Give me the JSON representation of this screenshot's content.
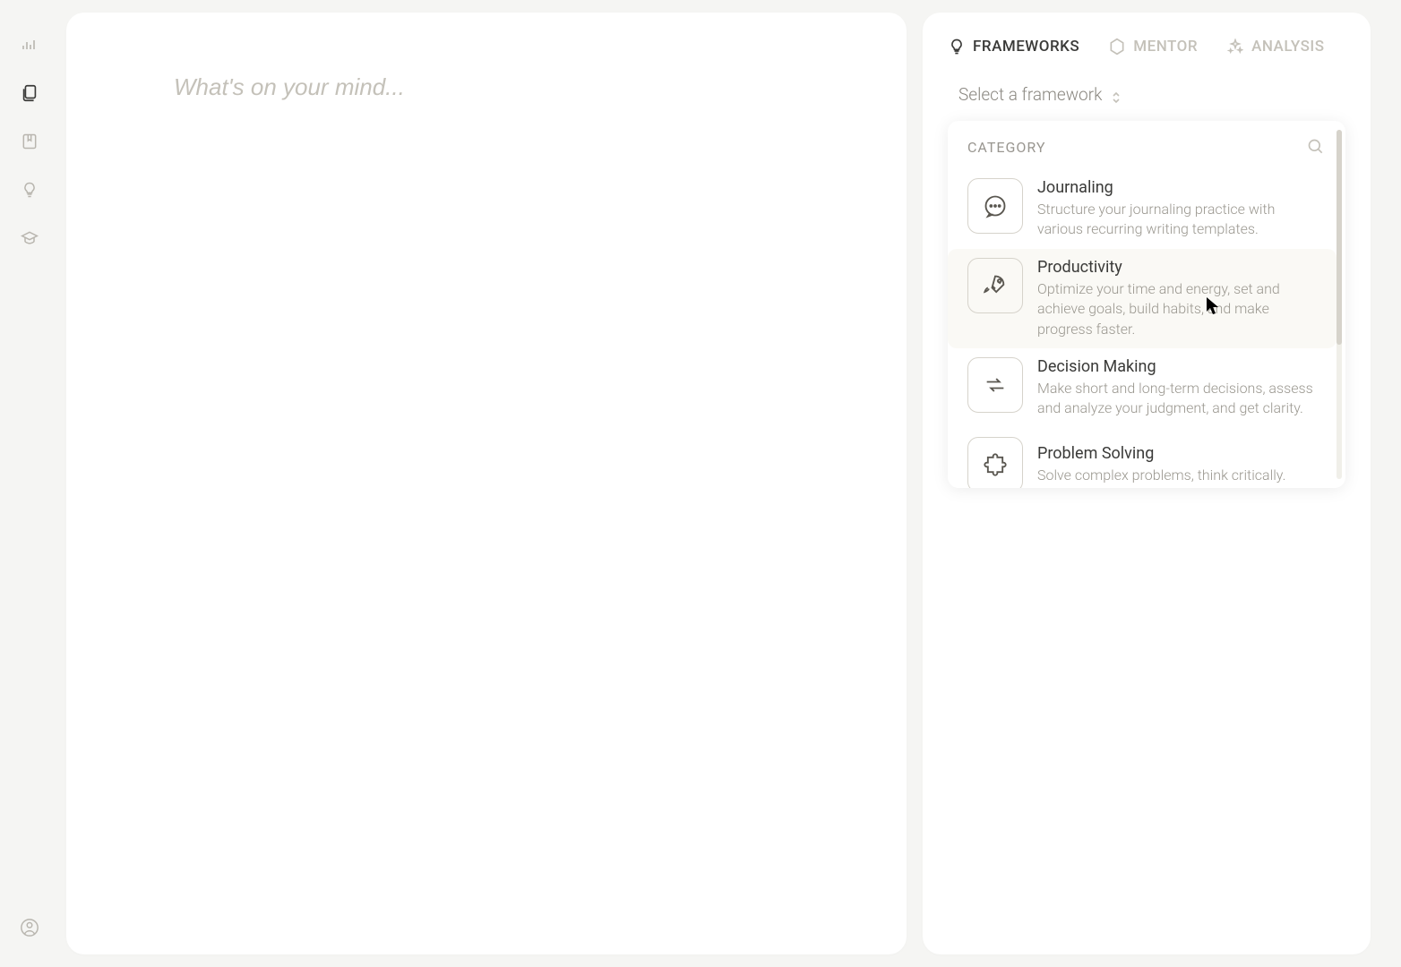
{
  "editor": {
    "placeholder": "What's on your mind..."
  },
  "tabs": [
    {
      "label": "FRAMEWORKS",
      "icon": "lightbulb",
      "active": true
    },
    {
      "label": "MENTOR",
      "icon": "hexagon",
      "active": false
    },
    {
      "label": "ANALYSIS",
      "icon": "sparkle",
      "active": false
    }
  ],
  "framework": {
    "select_label": "Select a framework",
    "category_label": "CATEGORY",
    "items": [
      {
        "title": "Journaling",
        "desc": "Structure your journaling practice with various recurring writing templates.",
        "icon": "chat"
      },
      {
        "title": "Productivity",
        "desc": "Optimize your time and energy, set and achieve goals, build habits, and make progress faster.",
        "icon": "rocket",
        "hover": true
      },
      {
        "title": "Decision Making",
        "desc": "Make short and long-term decisions, assess and analyze your judgment, and get clarity.",
        "icon": "arrows"
      },
      {
        "title": "Problem Solving",
        "desc": "Solve complex problems, think critically.",
        "icon": "puzzle"
      }
    ]
  }
}
